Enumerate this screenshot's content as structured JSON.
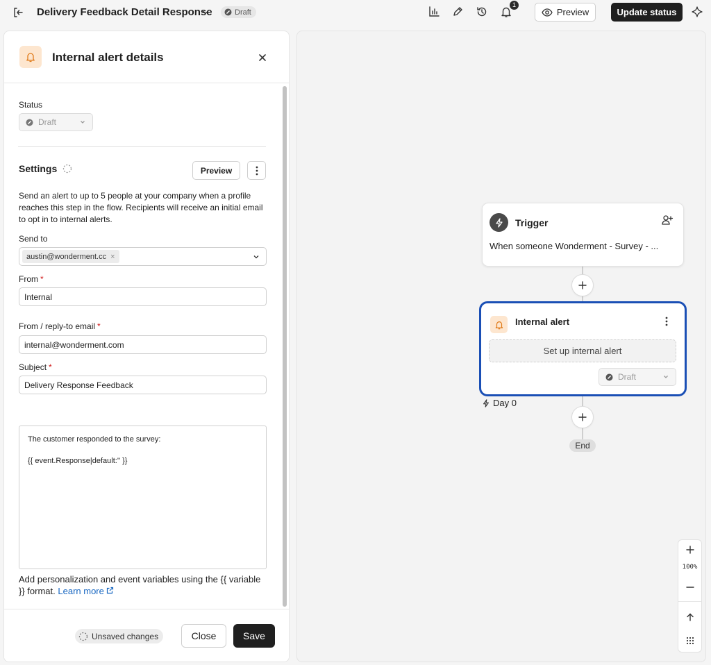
{
  "topbar": {
    "title": "Delivery Feedback Detail Response",
    "status_badge": "Draft",
    "notification_count": "1",
    "preview_label": "Preview",
    "update_status_label": "Update status"
  },
  "panel": {
    "title": "Internal alert details",
    "status_label": "Status",
    "status_value": "Draft",
    "settings_title": "Settings",
    "preview_label": "Preview",
    "description": "Send an alert to up to 5 people at your company when a profile reaches this step in the flow. Recipients will receive an initial email to opt in to internal alerts.",
    "send_to_label": "Send to",
    "send_to_chip": "austin@wonderment.cc",
    "from_label": "From",
    "from_value": "Internal",
    "reply_to_label": "From / reply-to email",
    "reply_to_value": "internal@wonderment.com",
    "subject_label": "Subject",
    "subject_value": "Delivery Response Feedback",
    "body_line1": "The customer responded to the survey:",
    "body_line2": "{{ event.Response|default:'' }}",
    "helper_text": "Add personalization and event variables using the {{ variable }} format.",
    "learn_more": "Learn more",
    "unsaved_label": "Unsaved changes",
    "close_label": "Close",
    "save_label": "Save"
  },
  "canvas": {
    "trigger_title": "Trigger",
    "trigger_text": "When someone Wonderment - Survey - ...",
    "alert_title": "Internal alert",
    "setup_label": "Set up internal alert",
    "alert_status": "Draft",
    "day_label": "Day 0",
    "end_label": "End",
    "zoom_level": "100%"
  },
  "colors": {
    "accent_selected": "#1a4fb5",
    "alert_icon_bg": "#fde6cf",
    "primary_button": "#1f1f1f",
    "link": "#1565c0",
    "required": "#d11c1c"
  }
}
